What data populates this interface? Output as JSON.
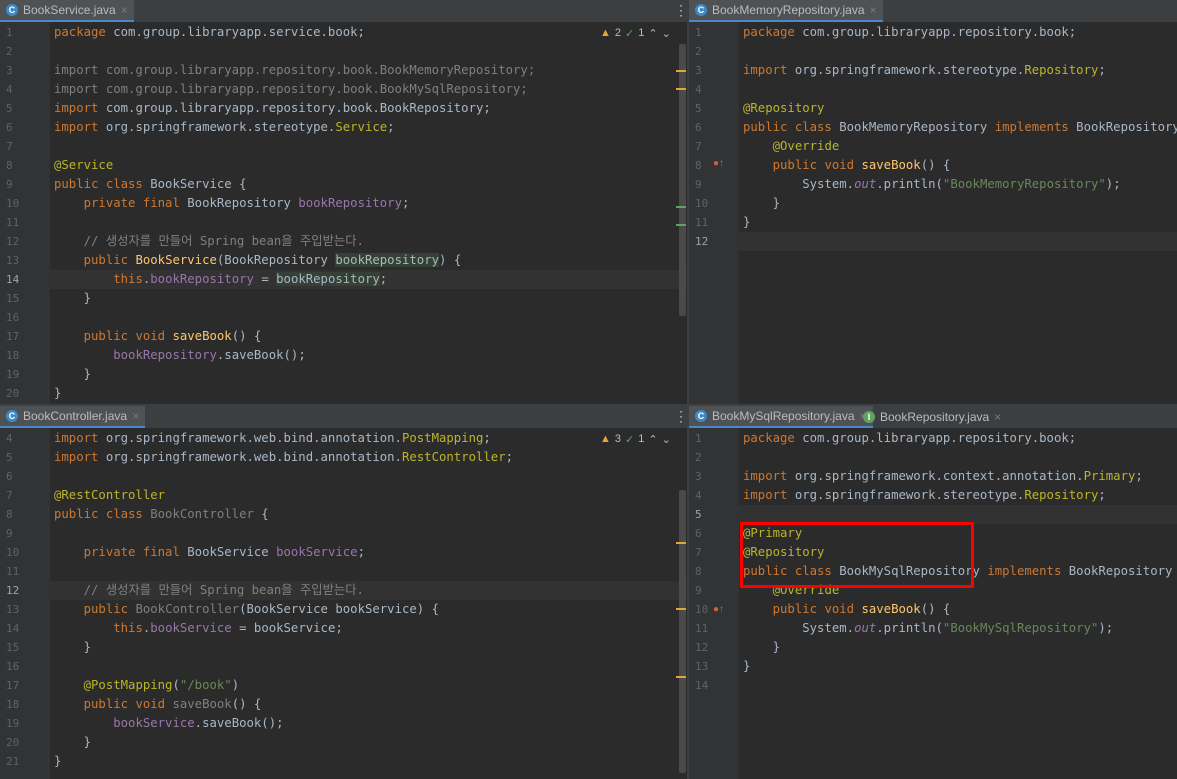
{
  "panes": {
    "top_left": {
      "tabs": [
        {
          "label": "BookService.java",
          "icon": "C",
          "icon_color": "#3d8ac7"
        }
      ],
      "inspection": {
        "warnings": "2",
        "checks": "1"
      },
      "lines": [
        {
          "n": "1",
          "html": "<span class='kw'>package</span> com.group.libraryapp.service.book;"
        },
        {
          "n": "2",
          "html": ""
        },
        {
          "n": "3",
          "html": "<span class='gr'>import com.group.libraryapp.repository.book.BookMemoryRepository;</span>"
        },
        {
          "n": "4",
          "html": "<span class='gr'>import com.group.libraryapp.repository.book.BookMySqlRepository;</span>"
        },
        {
          "n": "5",
          "html": "<span class='kw'>import</span> com.group.libraryapp.repository.book.BookRepository;"
        },
        {
          "n": "6",
          "html": "<span class='kw'>import</span> org.springframework.stereotype.<span class='an'>Service</span>;"
        },
        {
          "n": "7",
          "html": ""
        },
        {
          "n": "8",
          "html": "<span class='an'>@Service</span>"
        },
        {
          "n": "9",
          "html": "<span class='kw'>public class</span> BookService {"
        },
        {
          "n": "10",
          "html": "    <span class='kw'>private final</span> BookRepository <span class='fd'>bookRepository</span>;"
        },
        {
          "n": "11",
          "html": ""
        },
        {
          "n": "12",
          "html": "    <span class='cm'>// 생성자를 만들어 Spring bean을 주입받는다.</span>"
        },
        {
          "n": "13",
          "html": "    <span class='kw'>public</span> <span class='fn'>BookService</span>(BookRepository <span class='hl'>bookRepository</span>) {"
        },
        {
          "n": "14",
          "html": "        <span class='kw'>this</span>.<span class='fd'>bookRepository</span> = <span class='hl'>bookRepository</span>;"
        },
        {
          "n": "15",
          "html": "    }"
        },
        {
          "n": "16",
          "html": ""
        },
        {
          "n": "17",
          "html": "    <span class='kw'>public void</span> <span class='fn'>saveBook</span>() {"
        },
        {
          "n": "18",
          "html": "        <span class='fd'>bookRepository</span>.saveBook();"
        },
        {
          "n": "19",
          "html": "    }"
        },
        {
          "n": "20",
          "html": "}"
        }
      ],
      "current_line": "14"
    },
    "top_right": {
      "tabs": [
        {
          "label": "BookMemoryRepository.java",
          "icon": "C",
          "icon_color": "#3d8ac7"
        }
      ],
      "lines": [
        {
          "n": "1",
          "html": "<span class='kw'>package</span> com.group.libraryapp.repository.book;"
        },
        {
          "n": "2",
          "html": ""
        },
        {
          "n": "3",
          "html": "<span class='kw'>import</span> org.springframework.stereotype.<span class='an'>Repository</span>;"
        },
        {
          "n": "4",
          "html": ""
        },
        {
          "n": "5",
          "html": "<span class='an'>@Repository</span>"
        },
        {
          "n": "6",
          "html": "<span class='kw'>public class</span> BookMemoryRepository <span class='kw'>implements</span> BookRepository {"
        },
        {
          "n": "7",
          "html": "    <span class='an'>@Override</span>"
        },
        {
          "n": "8",
          "html": "    <span class='kw'>public void</span> <span class='fn'>saveBook</span>() {"
        },
        {
          "n": "9",
          "html": "        System.<span class='it'>out</span>.println(<span class='st'>\"BookMemoryRepository\"</span>);"
        },
        {
          "n": "10",
          "html": "    }"
        },
        {
          "n": "11",
          "html": "}"
        },
        {
          "n": "12",
          "html": ""
        }
      ],
      "current_line": "12"
    },
    "bottom_left": {
      "tabs": [
        {
          "label": "BookController.java",
          "icon": "C",
          "icon_color": "#3d8ac7"
        }
      ],
      "inspection": {
        "warnings": "3",
        "checks": "1"
      },
      "lines": [
        {
          "n": "4",
          "html": "<span class='kw'>import</span> org.springframework.web.bind.annotation.<span class='an'>PostMapping</span>;"
        },
        {
          "n": "5",
          "html": "<span class='kw'>import</span> org.springframework.web.bind.annotation.<span class='an'>RestController</span>;"
        },
        {
          "n": "6",
          "html": ""
        },
        {
          "n": "7",
          "html": "<span class='an'>@RestController</span>"
        },
        {
          "n": "8",
          "html": "<span class='kw'>public class</span> <span class='gr'>BookController</span> {"
        },
        {
          "n": "9",
          "html": ""
        },
        {
          "n": "10",
          "html": "    <span class='kw'>private final</span> BookService <span class='fd'>bookService</span>;"
        },
        {
          "n": "11",
          "html": ""
        },
        {
          "n": "12",
          "html": "    <span class='cm'>// 생성자를 만들어 Spring bean을 주입받는다.</span>"
        },
        {
          "n": "13",
          "html": "    <span class='kw'>public</span> <span class='gr'>BookController</span>(BookService bookService) {"
        },
        {
          "n": "14",
          "html": "        <span class='kw'>this</span>.<span class='fd'>bookService</span> = bookService;"
        },
        {
          "n": "15",
          "html": "    }"
        },
        {
          "n": "16",
          "html": ""
        },
        {
          "n": "17",
          "html": "    <span class='an'>@PostMapping</span>(<span class='st'>\"/book\"</span>)"
        },
        {
          "n": "18",
          "html": "    <span class='kw'>public void</span> <span class='gr'>saveBook</span>() {"
        },
        {
          "n": "19",
          "html": "        <span class='fd'>bookService</span>.saveBook();"
        },
        {
          "n": "20",
          "html": "    }"
        },
        {
          "n": "21",
          "html": "}"
        }
      ],
      "current_line": "12"
    },
    "bottom_right": {
      "tabs": [
        {
          "label": "BookMySqlRepository.java",
          "icon": "C",
          "icon_color": "#3d8ac7"
        },
        {
          "label": "BookRepository.java",
          "icon": "I",
          "icon_color": "#5fa35f"
        }
      ],
      "lines": [
        {
          "n": "1",
          "html": "<span class='kw'>package</span> com.group.libraryapp.repository.book;"
        },
        {
          "n": "2",
          "html": ""
        },
        {
          "n": "3",
          "html": "<span class='kw'>import</span> org.springframework.context.annotation.<span class='an'>Primary</span>;"
        },
        {
          "n": "4",
          "html": "<span class='kw'>import</span> org.springframework.stereotype.<span class='an'>Repository</span>;"
        },
        {
          "n": "5",
          "html": ""
        },
        {
          "n": "6",
          "html": "<span class='an'>@Primary</span>"
        },
        {
          "n": "7",
          "html": "<span class='an'>@Repository</span>"
        },
        {
          "n": "8",
          "html": "<span class='kw'>public class</span> BookMySqlRepository <span class='kw'>implements</span> BookRepository {"
        },
        {
          "n": "9",
          "html": "    <span class='an'>@Override</span>"
        },
        {
          "n": "10",
          "html": "    <span class='kw'>public void</span> <span class='fn'>saveBook</span>() {"
        },
        {
          "n": "11",
          "html": "        System.<span class='it'>out</span>.println(<span class='st'>\"BookMySqlRepository\"</span>);"
        },
        {
          "n": "12",
          "html": "    }"
        },
        {
          "n": "13",
          "html": "}"
        },
        {
          "n": "14",
          "html": ""
        }
      ],
      "current_line": "5"
    }
  },
  "colors": {
    "background": "#2b2b2b",
    "gutter": "#313335",
    "keyword": "#cc7832",
    "annotation": "#bbb529",
    "field": "#9876aa",
    "string": "#6a8759",
    "highlight_box": "#ff0000"
  },
  "icons": {
    "class_icon": "class-c-icon",
    "interface_icon": "interface-i-icon",
    "warning_icon": "warning-triangle-icon",
    "check_icon": "check-icon",
    "menu_icon": "kebab-menu-icon"
  }
}
